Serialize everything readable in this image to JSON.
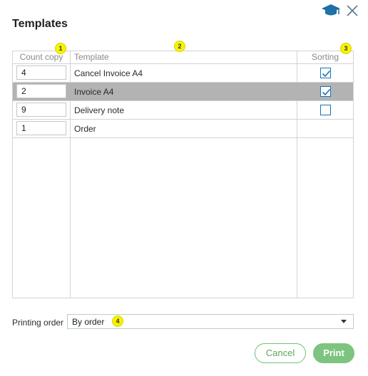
{
  "dialog": {
    "title": "Templates",
    "icons": {
      "help": "graduation-cap-icon",
      "close": "close-icon"
    }
  },
  "table": {
    "headers": {
      "count": "Count copy",
      "template": "Template",
      "sorting": "Sorting"
    },
    "rows": [
      {
        "count": "4",
        "template": "Cancel Invoice A4",
        "sorted": true,
        "selected": false
      },
      {
        "count": "2",
        "template": "Invoice A4",
        "sorted": true,
        "selected": true
      },
      {
        "count": "9",
        "template": "Delivery note",
        "sorted": false,
        "selected": false
      },
      {
        "count": "1",
        "template": "Order",
        "sorted": null,
        "selected": false
      }
    ]
  },
  "badges": [
    "1",
    "2",
    "3",
    "4"
  ],
  "printing_order": {
    "label": "Printing order",
    "value": "By order"
  },
  "buttons": {
    "cancel": "Cancel",
    "print": "Print"
  },
  "colors": {
    "accent_green": "#7cc47f",
    "checkbox_blue": "#1a73b8",
    "selected_row": "#b3b3b3",
    "badge_yellow": "#f7f300"
  }
}
